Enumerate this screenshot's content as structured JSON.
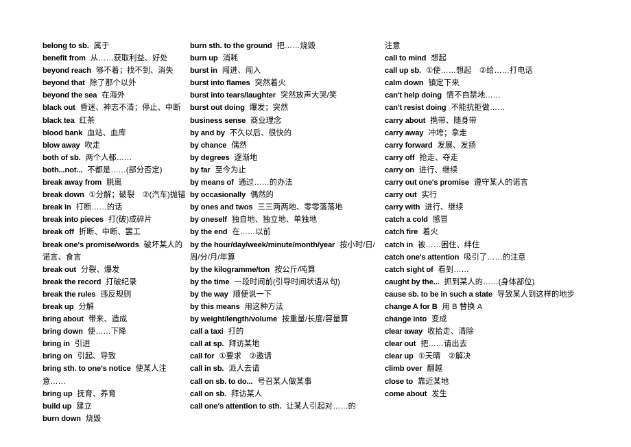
{
  "document": {
    "type": "english-chinese-phrase-glossary",
    "layout": "three-column",
    "background_color": "#ffffff",
    "text_color": "#000000"
  },
  "columns": [
    {
      "id": "column-1",
      "entries": [
        {
          "term": "belong to sb.",
          "def": "属于"
        },
        {
          "term": "benefit from",
          "def": "从……获取利益、好处"
        },
        {
          "term": "beyond reach",
          "def": "够不着；找不到、消失"
        },
        {
          "term": "beyond that",
          "def": "除了那个以外"
        },
        {
          "term": "beyond the sea",
          "def": "在海外"
        },
        {
          "term": "black out",
          "def": "昏迷、神志不清；停止、中断"
        },
        {
          "term": "black tea",
          "def": "红茶"
        },
        {
          "term": "blood bank",
          "def": "血站、血库"
        },
        {
          "term": "blow away",
          "def": "吹走"
        },
        {
          "term": "both of sb.",
          "def": "两个人都……"
        },
        {
          "term": "both...not...",
          "def": "不都是……(部分否定)"
        },
        {
          "term": "break away from",
          "def": "脱离"
        },
        {
          "term": "break down",
          "def": "①分解；破裂　②(汽车)抛锚"
        },
        {
          "term": "break in",
          "def": "打断……的话"
        },
        {
          "term": "break into pieces",
          "def": "打(破)成碎片"
        },
        {
          "term": "break off",
          "def": "折断、中断、罢工"
        },
        {
          "term": "break one's promise/words",
          "def": "破坏某人的诺言、食言"
        },
        {
          "term": "break out",
          "def": "分裂、爆发"
        },
        {
          "term": "break the record",
          "def": "打破纪录"
        },
        {
          "term": "break the rules",
          "def": "违反规则"
        },
        {
          "term": "break up",
          "def": "分解"
        },
        {
          "term": "bring about",
          "def": "带来、造成"
        },
        {
          "term": "bring down",
          "def": "使……下降"
        },
        {
          "term": "bring in",
          "def": "引进"
        },
        {
          "term": "bring on",
          "def": "引起、导致"
        },
        {
          "term": "bring sth. to one's notice",
          "def": "使某人注意……"
        },
        {
          "term": "bring up",
          "def": "抚育、养育"
        },
        {
          "term": "build up",
          "def": "建立"
        },
        {
          "term": "burn down",
          "def": "烧毁"
        }
      ]
    },
    {
      "id": "column-2",
      "entries": [
        {
          "term": "burn sth. to the ground",
          "def": "把……烧毁"
        },
        {
          "term": "burn up",
          "def": "消耗"
        },
        {
          "term": "burst in",
          "def": "闯进、闯入"
        },
        {
          "term": "burst into flames",
          "def": "突然着火"
        },
        {
          "term": "burst into tears/laughter",
          "def": "突然放声大哭/笑"
        },
        {
          "term": "burst out doing",
          "def": "爆发；突然"
        },
        {
          "term": "business sense",
          "def": "商业理念"
        },
        {
          "term": "by and by",
          "def": "不久以后、很快的"
        },
        {
          "term": "by chance",
          "def": "偶然"
        },
        {
          "term": "by degrees",
          "def": "逐渐地"
        },
        {
          "term": "by far",
          "def": "至今为止"
        },
        {
          "term": "by means of",
          "def": "通过……的办法"
        },
        {
          "term": "by occasionally",
          "def": "偶然的"
        },
        {
          "term": "by ones and twos",
          "def": "三三两两地、零零落落地"
        },
        {
          "term": "by oneself",
          "def": "独自地、独立地、单独地"
        },
        {
          "term": "by the end",
          "def": "在……以前"
        },
        {
          "term": "by the hour/day/week/minute/month/year",
          "def": "按小时/日/周/分/月/年算"
        },
        {
          "term": "by the kilogramme/ton",
          "def": "按公斤/吨算"
        },
        {
          "term": "by the time",
          "def": "一段时间前(引导时间状语从句)"
        },
        {
          "term": "by the way",
          "def": "顺便说一下"
        },
        {
          "term": "by this means",
          "def": "用这种方法"
        },
        {
          "term": "by weight/length/volume",
          "def": "按重量/长度/容量算"
        },
        {
          "term": "call a taxi",
          "def": "打的"
        },
        {
          "term": "call at sp.",
          "def": "拜访某地"
        },
        {
          "term": "call for",
          "def": "①要求　②邀请"
        },
        {
          "term": "call in sb.",
          "def": "派人去请"
        },
        {
          "term": "call on sb. to do...",
          "def": "号召某人做某事"
        },
        {
          "term": "call on sb.",
          "def": "拜访某人"
        },
        {
          "term": "call one's attention to sth.",
          "def": "让某人引起对……的"
        }
      ]
    },
    {
      "id": "column-3",
      "entries": [
        {
          "term": "",
          "def": "注意"
        },
        {
          "term": "call to mind",
          "def": "想起"
        },
        {
          "term": "call up sb.",
          "def": "①使……想起　②给……打电话"
        },
        {
          "term": "calm down",
          "def": "镇定下来"
        },
        {
          "term": "can't help doing",
          "def": "情不自禁地……"
        },
        {
          "term": "can't resist doing",
          "def": "不能抗拒做……"
        },
        {
          "term": "carry about",
          "def": "携带、随身带"
        },
        {
          "term": "carry away",
          "def": "冲垮；拿走"
        },
        {
          "term": "carry forward",
          "def": "发展、发扬"
        },
        {
          "term": "carry off",
          "def": "抢走、夺走"
        },
        {
          "term": "carry on",
          "def": "进行、继续"
        },
        {
          "term": "carry out one's promise",
          "def": "遵守某人的诺言"
        },
        {
          "term": "carry out",
          "def": "实行"
        },
        {
          "term": "carry with",
          "def": "进行、继续"
        },
        {
          "term": "catch a cold",
          "def": "感冒"
        },
        {
          "term": "catch fire",
          "def": "着火"
        },
        {
          "term": "catch in",
          "def": "被……困住、绊住"
        },
        {
          "term": "catch one's attention",
          "def": "吸引了……的注意"
        },
        {
          "term": "catch sight of",
          "def": "看到……"
        },
        {
          "term": "caught by the...",
          "def": "抓到某人的……(身体部位)"
        },
        {
          "term": "cause sb. to be in such a state",
          "def": "导致某人到这样的地步"
        },
        {
          "term": "change A for B",
          "def": "用 B 替换 A"
        },
        {
          "term": "change into",
          "def": "变成"
        },
        {
          "term": "clear away",
          "def": "收拾走、清除"
        },
        {
          "term": "clear out",
          "def": "把……请出去"
        },
        {
          "term": "clear up",
          "def": "①天晴　②解决"
        },
        {
          "term": "climb over",
          "def": "翻越"
        },
        {
          "term": "close to",
          "def": "靠近某地"
        },
        {
          "term": "come about",
          "def": "发生"
        }
      ]
    }
  ]
}
